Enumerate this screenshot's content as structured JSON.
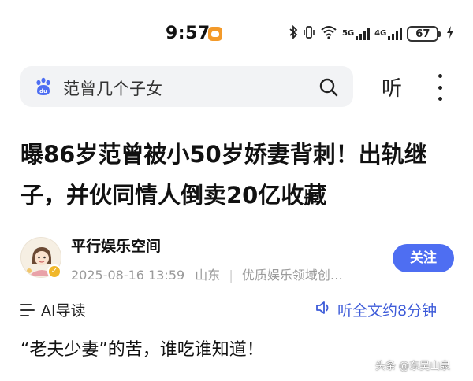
{
  "status_bar": {
    "time": "9:57",
    "network_5g": "5G",
    "network_4g": "4G",
    "battery": "67",
    "icons": [
      "bluetooth-icon",
      "vibrate-icon",
      "wifi-icon",
      "signal-5g-icon",
      "signal-4g-icon",
      "battery-icon",
      "charging-icon"
    ]
  },
  "search": {
    "query": "范曾几个子女",
    "listen_label": "听"
  },
  "article": {
    "title": "曝86岁范曾被小50岁娇妻背刺！出轨继子，并伙同情人倒卖20亿收藏",
    "author": "平行娱乐空间",
    "date": "2025-08-16 13:59",
    "location": "山东",
    "tag": "优质娱乐领域创…",
    "follow_label": "关注",
    "ai_guide_label": "AI导读",
    "listen_full_label": "听全文约8分钟",
    "first_paragraph": "“老夫少妻”的苦，谁吃谁知道！"
  },
  "watermark": "头条 @东吴山泉",
  "colors": {
    "accent": "#4e6ef2",
    "link": "#3d5bd9",
    "search_bg": "#f2f3f5",
    "meta_text": "#9a9a9a"
  }
}
